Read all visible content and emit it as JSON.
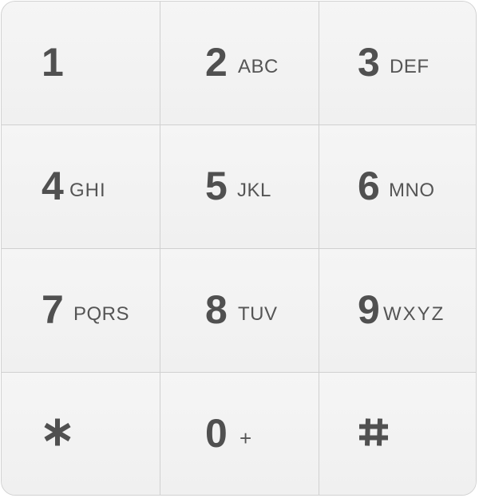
{
  "keypad": {
    "keys": [
      {
        "digit": "1",
        "letters": ""
      },
      {
        "digit": "2",
        "letters": "ABC"
      },
      {
        "digit": "3",
        "letters": "DEF"
      },
      {
        "digit": "4",
        "letters": "GHI"
      },
      {
        "digit": "5",
        "letters": "JKL"
      },
      {
        "digit": "6",
        "letters": "MNO"
      },
      {
        "digit": "7",
        "letters": "PQRS"
      },
      {
        "digit": "8",
        "letters": "TUV"
      },
      {
        "digit": "9",
        "letters": "WXYZ"
      },
      {
        "icon": "asterisk-icon"
      },
      {
        "digit": "0",
        "letters": "+"
      },
      {
        "icon": "hash-icon"
      }
    ],
    "colors": {
      "key_background": "#f1f1f1",
      "text": "#505050",
      "divider": "#d0d0d0"
    }
  }
}
